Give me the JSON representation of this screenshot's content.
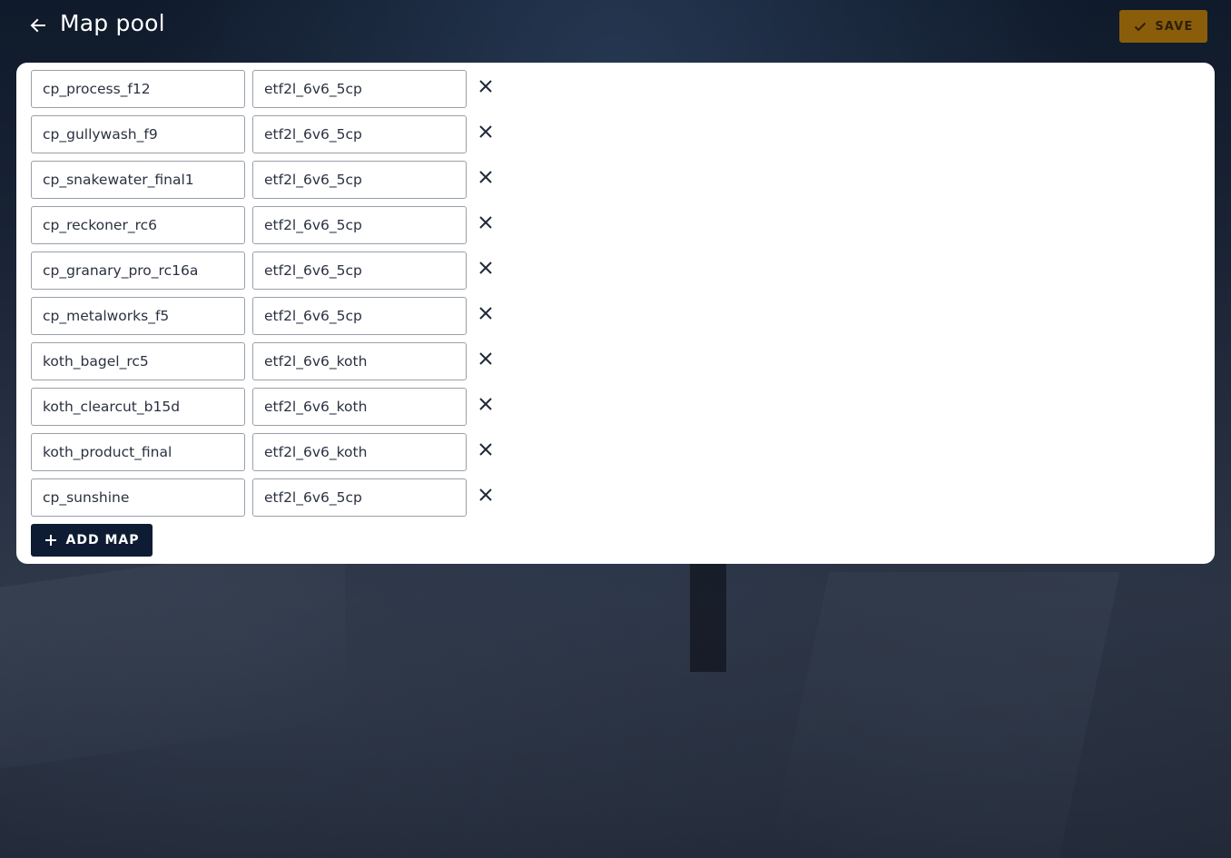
{
  "header": {
    "title": "Map pool",
    "back_icon": "arrow-left-icon",
    "save_label": "SAVE",
    "save_icon": "check-icon"
  },
  "colors": {
    "save_bg": "#8a5d0a",
    "save_text": "#2d1f05",
    "add_bg": "#0d1c33",
    "panel_bg": "#ffffff"
  },
  "maps": [
    {
      "map": "cp_process_f12",
      "config": "etf2l_6v6_5cp"
    },
    {
      "map": "cp_gullywash_f9",
      "config": "etf2l_6v6_5cp"
    },
    {
      "map": "cp_snakewater_final1",
      "config": "etf2l_6v6_5cp"
    },
    {
      "map": "cp_reckoner_rc6",
      "config": "etf2l_6v6_5cp"
    },
    {
      "map": "cp_granary_pro_rc16a",
      "config": "etf2l_6v6_5cp"
    },
    {
      "map": "cp_metalworks_f5",
      "config": "etf2l_6v6_5cp"
    },
    {
      "map": "koth_bagel_rc5",
      "config": "etf2l_6v6_koth"
    },
    {
      "map": "koth_clearcut_b15d",
      "config": "etf2l_6v6_koth"
    },
    {
      "map": "koth_product_final",
      "config": "etf2l_6v6_koth"
    },
    {
      "map": "cp_sunshine",
      "config": "etf2l_6v6_5cp"
    }
  ],
  "remove_icon": "close-icon",
  "add_map": {
    "label": "ADD MAP",
    "icon": "plus-icon"
  }
}
